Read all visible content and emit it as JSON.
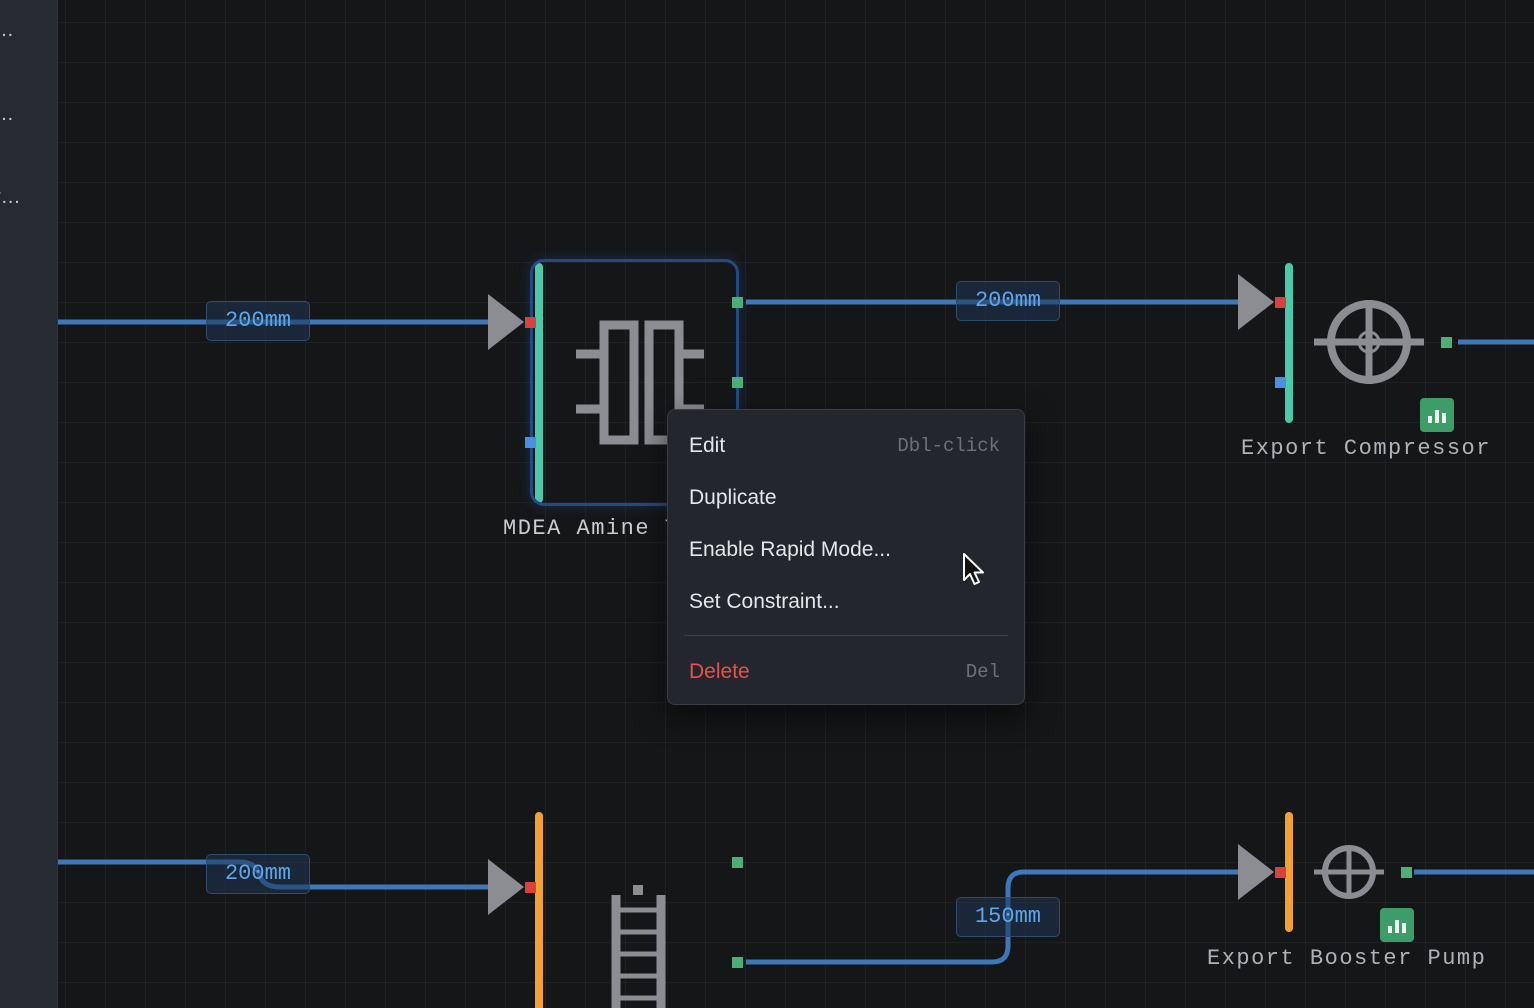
{
  "sidebar": {
    "items": [
      {
        "label": "…"
      },
      {
        "label": "…"
      },
      {
        "label": "r…"
      }
    ]
  },
  "pipes": {
    "top_left": "200mm",
    "top_right": "200mm",
    "bottom_left": "200mm",
    "bottom_right": "150mm"
  },
  "nodes": {
    "amine": {
      "label": "MDEA Amine T"
    },
    "compressor": {
      "label": "Export Compressor"
    },
    "booster": {
      "label": "Export Booster Pump"
    }
  },
  "context_menu": {
    "items": [
      {
        "label": "Edit",
        "shortcut": "Dbl-click"
      },
      {
        "label": "Duplicate",
        "shortcut": ""
      },
      {
        "label": "Enable Rapid Mode...",
        "shortcut": ""
      },
      {
        "label": "Set Constraint...",
        "shortcut": ""
      }
    ],
    "delete": {
      "label": "Delete",
      "shortcut": "Del"
    }
  },
  "colors": {
    "pipe": "#3f78b8",
    "inlet_bar_teal": "#4cc9a8",
    "inlet_bar_orange": "#f0a332",
    "equipment_gray": "#8b8d93",
    "port_green": "#4caf76",
    "port_red": "#d9413c",
    "danger": "#e5534b"
  }
}
